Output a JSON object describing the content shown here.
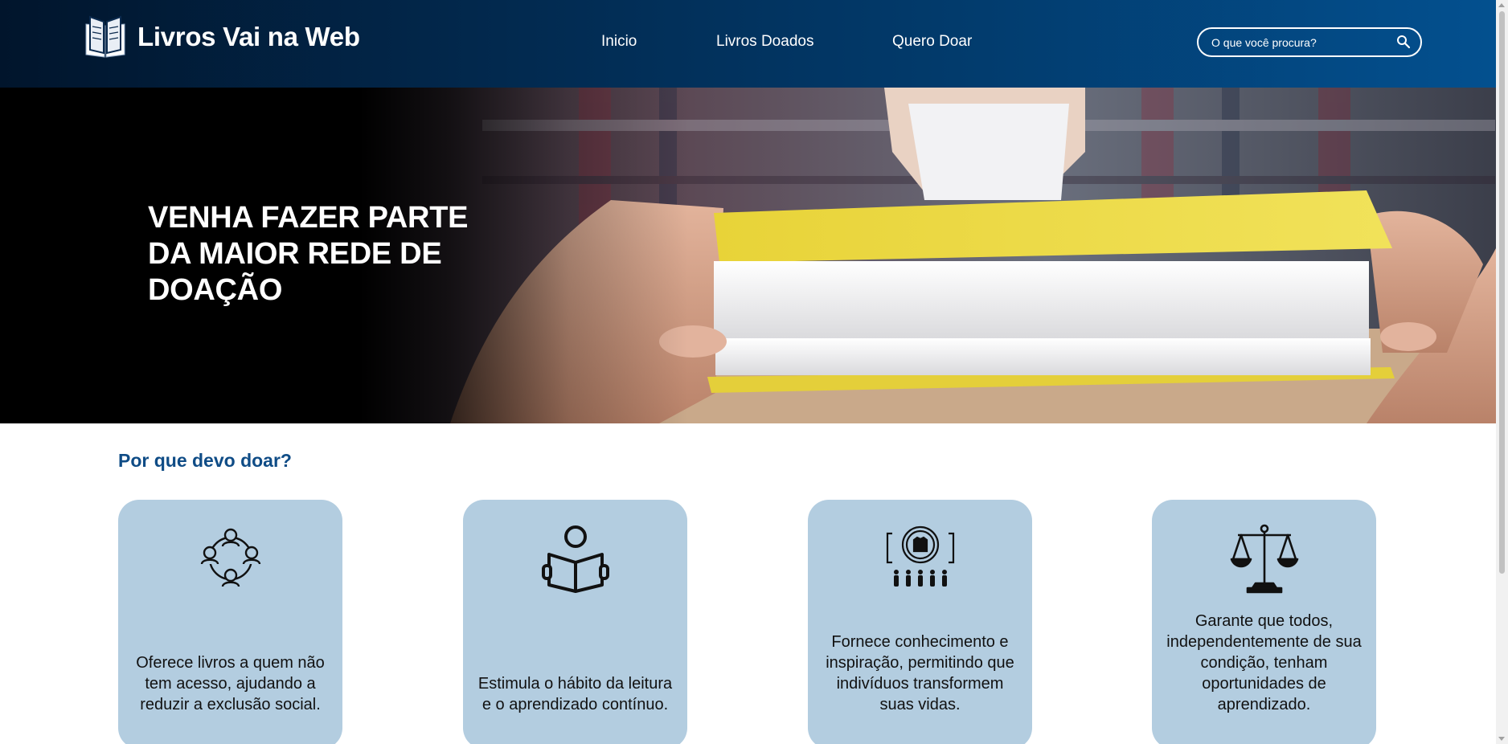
{
  "brand": {
    "name": "Livros Vai na Web",
    "icon": "open-book-icon"
  },
  "nav": {
    "items": [
      "Inicio",
      "Livros Doados",
      "Quero Doar"
    ]
  },
  "search": {
    "placeholder": "O que você procura?",
    "icon": "search-icon"
  },
  "hero": {
    "title": "VENHA FAZER PARTE DA MAIOR REDE DE DOAÇÃO"
  },
  "why": {
    "title": "Por que devo doar?",
    "cards": [
      {
        "icon": "community-circle-icon",
        "text": "Oferece livros a quem não tem acesso, ajudando a reduzir a exclusão social."
      },
      {
        "icon": "person-reading-icon",
        "text": "Estimula o hábito da leitura e o aprendizado contínuo."
      },
      {
        "icon": "raised-fist-people-icon",
        "text": "Fornece conhecimento e inspiração, permitindo que indivíduos transformem suas vidas."
      },
      {
        "icon": "justice-scale-icon",
        "text": "Garante que todos, independentemente de sua condição, tenham oportunidades de aprendizado."
      }
    ]
  },
  "colors": {
    "header_dark": "#01152c",
    "header_light": "#03508f",
    "section_title": "#0f4c86",
    "card_background": "#b3cde0"
  }
}
